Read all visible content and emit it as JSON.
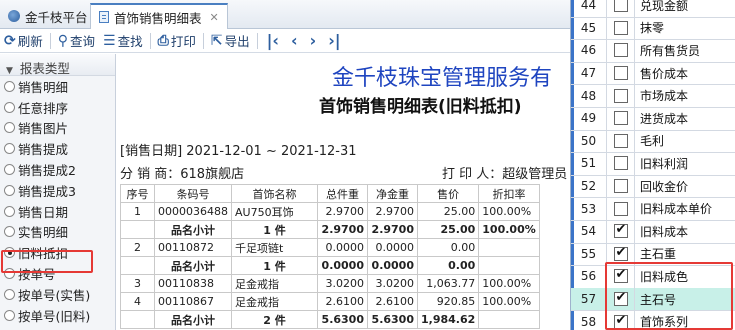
{
  "tabs": {
    "home": "金千枝平台",
    "active": "首饰销售明细表",
    "close": "✕"
  },
  "toolbar": {
    "refresh": "刷新",
    "query": "查询",
    "find": "查找",
    "print": "打印",
    "export": "导出"
  },
  "sidebar": {
    "header": "报表类型",
    "items": [
      "销售明细",
      "任意排序",
      "销售图片",
      "销售提成",
      "销售提成2",
      "销售提成3",
      "销售日期",
      "实售明细",
      "旧料抵扣",
      "按单号",
      "按单号(实售)",
      "按单号(旧料)"
    ],
    "selected_index": 8
  },
  "report": {
    "title": "金千枝珠宝管理服务有",
    "subtitle": "首饰销售明细表(旧料抵扣)",
    "date_label": "[销售日期] 2021-12-01 ~ 2021-12-31",
    "branch_label": "分 销 商：618旗舰店",
    "printer_label": "打 印 人：超级管理员",
    "columns": [
      "序号",
      "条码号",
      "首饰名称",
      "总件重",
      "净金重",
      "售价",
      "折扣率"
    ],
    "rows": [
      {
        "type": "item",
        "cells": [
          "1",
          "0000036488",
          "AU750耳饰",
          "2.9700",
          "2.9700",
          "25.00",
          "100.00%"
        ]
      },
      {
        "type": "sub",
        "cells": [
          "",
          "品名小计",
          "1 件",
          "2.9700",
          "2.9700",
          "25.00",
          "100.00%"
        ]
      },
      {
        "type": "item",
        "cells": [
          "2",
          "00110872",
          "千足项链t",
          "0.0000",
          "0.0000",
          "0.00",
          ""
        ]
      },
      {
        "type": "sub",
        "cells": [
          "",
          "品名小计",
          "1 件",
          "0.0000",
          "0.0000",
          "0.00",
          ""
        ]
      },
      {
        "type": "item",
        "cells": [
          "3",
          "00110838",
          "足金戒指",
          "3.0200",
          "3.0200",
          "1,063.77",
          "100.00%"
        ]
      },
      {
        "type": "item",
        "cells": [
          "4",
          "00110867",
          "足金戒指",
          "2.6100",
          "2.6100",
          "920.85",
          "100.00%"
        ]
      },
      {
        "type": "sub",
        "cells": [
          "",
          "品名小计",
          "2 件",
          "5.6300",
          "5.6300",
          "1,984.62",
          ""
        ]
      }
    ]
  },
  "columns_panel": {
    "rows": [
      {
        "num": "44",
        "checked": false,
        "label": "兑现金额"
      },
      {
        "num": "45",
        "checked": false,
        "label": "抹零"
      },
      {
        "num": "46",
        "checked": false,
        "label": "所有售货员"
      },
      {
        "num": "47",
        "checked": false,
        "label": "售价成本"
      },
      {
        "num": "48",
        "checked": false,
        "label": "市场成本"
      },
      {
        "num": "49",
        "checked": false,
        "label": "进货成本"
      },
      {
        "num": "50",
        "checked": false,
        "label": "毛利"
      },
      {
        "num": "51",
        "checked": false,
        "label": "旧料利润"
      },
      {
        "num": "52",
        "checked": false,
        "label": "回收金价"
      },
      {
        "num": "53",
        "checked": false,
        "label": "旧料成本单价"
      },
      {
        "num": "54",
        "checked": true,
        "label": "旧料成本"
      },
      {
        "num": "55",
        "checked": true,
        "label": "主石重"
      },
      {
        "num": "56",
        "checked": true,
        "label": "旧料成色"
      },
      {
        "num": "57",
        "checked": true,
        "label": "主石号"
      },
      {
        "num": "58",
        "checked": true,
        "label": "首饰系列"
      }
    ],
    "selected_num": "57"
  },
  "colors": {
    "highlight_red": "#e53935",
    "selected_row": "#c8f0e8",
    "title_blue": "#1f45c0"
  }
}
